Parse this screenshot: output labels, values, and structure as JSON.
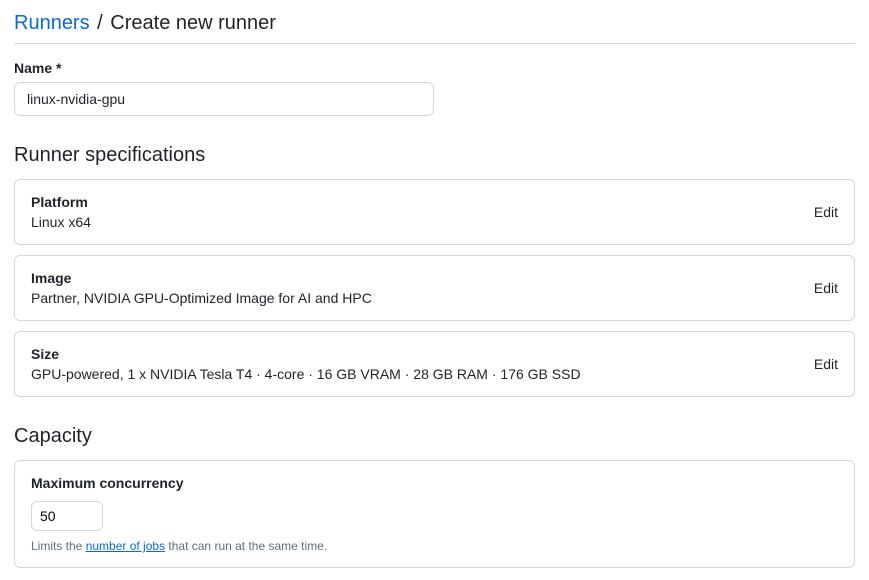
{
  "breadcrumb": {
    "parent": "Runners",
    "separator": "/",
    "current": "Create new runner"
  },
  "nameField": {
    "label": "Name *",
    "value": "linux-nvidia-gpu"
  },
  "specsSection": {
    "title": "Runner specifications",
    "items": [
      {
        "label": "Platform",
        "value": "Linux x64",
        "edit": "Edit"
      },
      {
        "label": "Image",
        "value": "Partner, NVIDIA GPU-Optimized Image for AI and HPC",
        "edit": "Edit"
      },
      {
        "label": "Size",
        "value": "GPU-powered, 1 x NVIDIA Tesla T4 · 4-core · 16 GB VRAM · 28 GB RAM · 176 GB SSD",
        "edit": "Edit"
      }
    ]
  },
  "capacitySection": {
    "title": "Capacity",
    "concurrency": {
      "label": "Maximum concurrency",
      "value": "50",
      "helpPrefix": "Limits the ",
      "helpLink": "number of jobs",
      "helpSuffix": " that can run at the same time."
    }
  }
}
